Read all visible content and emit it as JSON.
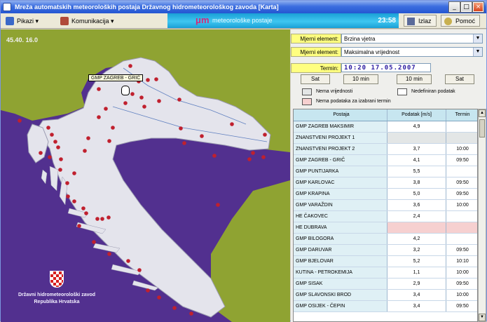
{
  "window": {
    "title": "Mreža automatskih meteoroloških postaja Državnog hidrometeorološkog zavoda   [Karta]",
    "controls": [
      "_",
      "□",
      "×"
    ]
  },
  "menubar": {
    "pikazi": "Pikazi ▾",
    "komunikacija": "Komunikacija ▾",
    "banner_logo": "μm",
    "banner_sub": "meteorološke postaje",
    "clock": "23:58",
    "izlaz": "Izlaz",
    "pomoc": "Pomoć"
  },
  "map": {
    "coords": "45.40.  16.0",
    "tooltip": "GMP ZAGREB - GRIČ",
    "org_line1": "Državni hidrometeorološki zavod",
    "org_line2": "Republika Hrvatska",
    "colors": {
      "sea": "#52308f",
      "land": "#e4e4ec",
      "outside": "#8fa332",
      "station": "#c0202e"
    }
  },
  "controls": {
    "element_label": "Mjerni element:",
    "element_value": "Brzina vjetra",
    "type_label": "Mjerni element:",
    "type_value": "Maksimalna vrijednost",
    "time_label": "Termin:",
    "time_value": "10:20  17.05.2007",
    "btn_back_hour": "Sat",
    "btn_back_10": "10 min",
    "btn_fwd_10": "10 min",
    "btn_fwd_hour": "Sat"
  },
  "legend": {
    "no_value": "Nema vrijednosti",
    "incomplete": "Nedefiniran podatak",
    "no_data": "Nema podataka za izabrani termin"
  },
  "table": {
    "headers": [
      "Postaja",
      "Podatak [m/s]",
      "Termin"
    ],
    "rows": [
      {
        "station": "GMP ZAGREB MAKSIMIR",
        "value": "4,9",
        "time": ""
      },
      {
        "station": "ZNANSTVENI PROJEKT 1",
        "value": "",
        "time": ""
      },
      {
        "station": "ZNANSTVENI PROJEKT 2",
        "value": "3,7",
        "time": "10:00"
      },
      {
        "station": "GMP ZAGREB - GRIČ",
        "value": "4,1",
        "time": "09:50"
      },
      {
        "station": "GMP PUNTIJARKA",
        "value": "5,5",
        "time": ""
      },
      {
        "station": "GMP KARLOVAC",
        "value": "3,8",
        "time": "09:50"
      },
      {
        "station": "GMP KRAPINA",
        "value": "5,0",
        "time": "09:50"
      },
      {
        "station": "GMP VARAŽDIN",
        "value": "3,6",
        "time": "10:00"
      },
      {
        "station": "HE ČAKOVEC",
        "value": "2,4",
        "time": ""
      },
      {
        "station": "HE DUBRAVA",
        "value": "",
        "time": ""
      },
      {
        "station": "GMP BILOGORA",
        "value": "4,2",
        "time": ""
      },
      {
        "station": "GMP DARUVAR",
        "value": "3,2",
        "time": "09:50"
      },
      {
        "station": "GMP BJELOVAR",
        "value": "5,2",
        "time": "10:10"
      },
      {
        "station": "KUTINA - PETROKEMIJA",
        "value": "1,1",
        "time": "10:00"
      },
      {
        "station": "GMP SISAK",
        "value": "2,9",
        "time": "09:50"
      },
      {
        "station": "GMP SLAVONSKI BROD",
        "value": "3,4",
        "time": "10:00"
      },
      {
        "station": "GMP OSIJEK - ČEPIN",
        "value": "3,4",
        "time": "09:50"
      }
    ]
  }
}
